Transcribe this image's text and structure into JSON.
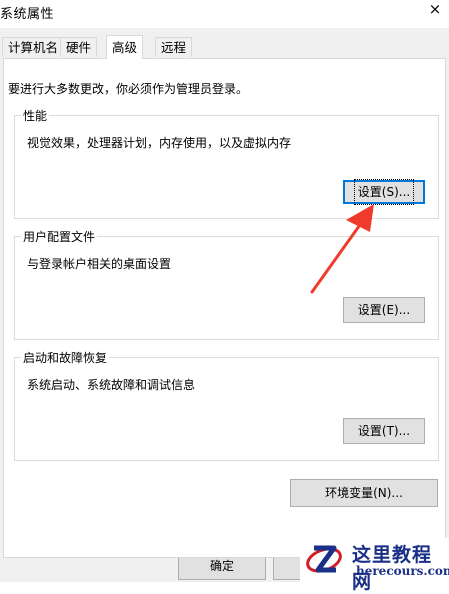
{
  "window": {
    "title": "系统属性",
    "close_glyph": "×"
  },
  "tabs": [
    {
      "label": "计算机名"
    },
    {
      "label": "硬件"
    },
    {
      "label": "高级"
    },
    {
      "label": "远程"
    }
  ],
  "active_tab": "高级",
  "notice": "要进行大多数更改，你必须作为管理员登录。",
  "performance": {
    "legend": "性能",
    "description": "视觉效果，处理器计划，内存使用，以及虚拟内存",
    "button": "设置(S)..."
  },
  "user_profiles": {
    "legend": "用户配置文件",
    "description": "与登录帐户相关的桌面设置",
    "button": "设置(E)..."
  },
  "startup_recovery": {
    "legend": "启动和故障恢复",
    "description": "系统启动、系统故障和调试信息",
    "button": "设置(T)..."
  },
  "env_button": "环境变量(N)...",
  "footer": {
    "ok_button": "确定"
  },
  "watermark": {
    "cn": "这里教程网",
    "en": "herecours.com"
  },
  "colors": {
    "arrow": "#f03a2b",
    "focus_border": "#0078d7",
    "watermark": "#1a2f87"
  }
}
